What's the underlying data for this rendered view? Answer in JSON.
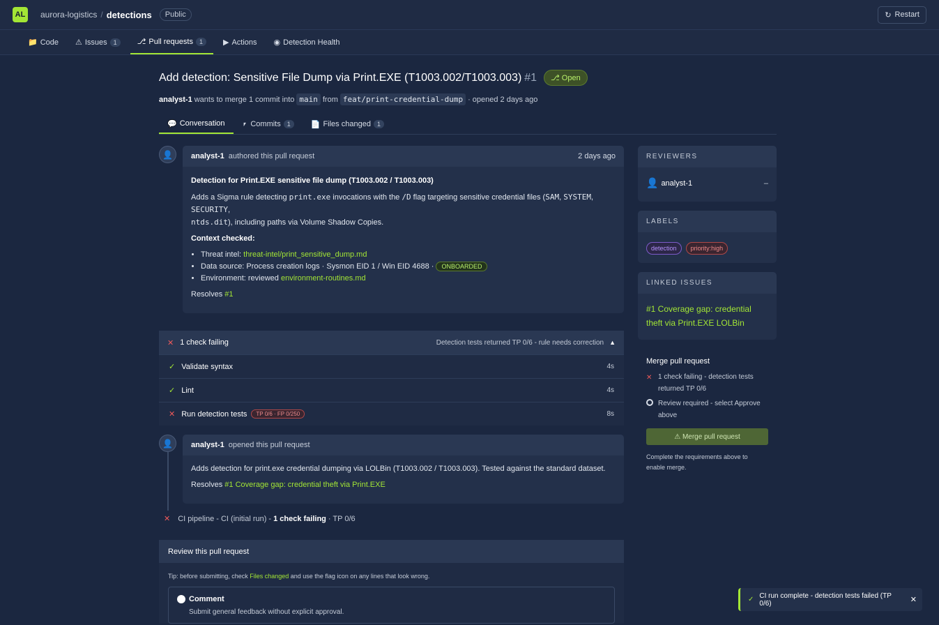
{
  "header": {
    "logo": "AL",
    "owner": "aurora-logistics",
    "separator": "/",
    "repo": "detections",
    "visibility": "Public",
    "restart": "Restart"
  },
  "repo_tabs": [
    {
      "icon": "📁",
      "label": "Code",
      "count": ""
    },
    {
      "icon": "⚠",
      "label": "Issues",
      "count": "1"
    },
    {
      "icon": "⎇",
      "label": "Pull requests",
      "count": "1"
    },
    {
      "icon": "▶",
      "label": "Actions",
      "count": ""
    },
    {
      "icon": "◉",
      "label": "Detection Health",
      "count": ""
    }
  ],
  "pr": {
    "title": "Add detection: Sensitive File Dump via Print.EXE (T1003.002/T1003.003)",
    "number": "#1",
    "status": "⎇ Open",
    "author": "analyst-1",
    "merge_text": "wants to merge 1 commit into",
    "base": "main",
    "from": "from",
    "head": "feat/print-credential-dump",
    "opened": "· opened 2 days ago"
  },
  "pr_tabs": [
    {
      "icon": "💬",
      "label": "Conversation",
      "count": ""
    },
    {
      "icon": "⎖",
      "label": "Commits",
      "count": "1"
    },
    {
      "icon": "📄",
      "label": "Files changed",
      "count": "1"
    }
  ],
  "description": {
    "author": "analyst-1",
    "action": "authored this pull request",
    "time": "2 days ago",
    "heading": "Detection for Print.EXE sensitive file dump (T1003.002 / T1003.003)",
    "p1a": "Adds a Sigma rule detecting ",
    "p1code1": "print.exe",
    "p1b": " invocations with the ",
    "p1code2": "/D",
    "p1c": " flag targeting sensitive credential files (",
    "p1code3": "SAM",
    "p1code4": "SYSTEM",
    "p1code5": "SECURITY",
    "p1code6": "ntds.dit",
    "p1d": "), including paths via Volume Shadow Copies.",
    "context": "Context checked:",
    "li1_label": "Threat intel: ",
    "li1_link": "threat-intel/print_sensitive_dump.md",
    "li2_label": "Data source: Process creation logs · Sysmon EID 1 / Win EID 4688 · ",
    "li2_badge": "ONBOARDED",
    "li3_label": "Environment: reviewed ",
    "li3_link": "environment-routines.md",
    "resolves": "Resolves ",
    "resolves_link": "#1"
  },
  "checks": {
    "header": "1 check failing",
    "summary": "Detection tests returned TP 0/6 - rule needs correction",
    "rows": [
      {
        "name": "Validate syntax",
        "duration": "4s",
        "badge": ""
      },
      {
        "name": "Lint",
        "duration": "4s",
        "badge": ""
      },
      {
        "name": "Run detection tests",
        "duration": "8s",
        "badge": "TP 0/6 · FP 0/250"
      }
    ]
  },
  "event": {
    "author": "analyst-1",
    "action": "opened this pull request",
    "body": "Adds detection for print.exe credential dumping via LOLBin (T1003.002 / T1003.003). Tested against the standard dataset.",
    "resolves": "Resolves ",
    "resolves_link": "#1 Coverage gap: credential theft via Print.EXE"
  },
  "ci": {
    "text": "CI pipeline - CI (initial run) -",
    "bold": "1 check failing",
    "tail": "· TP 0/6"
  },
  "review": {
    "title": "Review this pull request",
    "tip_a": "Tip: before submitting, check ",
    "tip_link": "Files changed",
    "tip_b": " and use the flag icon on any lines that look wrong.",
    "option_label": "Comment",
    "option_desc": "Submit general feedback without explicit approval."
  },
  "sidebar": {
    "reviewers_title": "REVIEWERS",
    "reviewer": "analyst-1",
    "reviewer_state": "–",
    "labels_title": "LABELS",
    "labels": [
      "detection",
      "priority:high"
    ],
    "linked_title": "LINKED ISSUES",
    "linked_issue": "#1 Coverage gap: credential theft via Print.EXE LOLBin"
  },
  "merge": {
    "title": "Merge pull request",
    "req1": "1 check failing - detection tests returned TP 0/6",
    "req2": "Review required - select Approve above",
    "button": "⚠ Merge pull request",
    "note": "Complete the requirements above to enable merge."
  },
  "toast": {
    "icon": "✓",
    "text": "CI run complete - detection tests failed (TP 0/6)",
    "close": "✕"
  },
  "colors": {
    "accent": "#a3e635",
    "background": "#1b2740",
    "danger": "#f05a5a"
  }
}
